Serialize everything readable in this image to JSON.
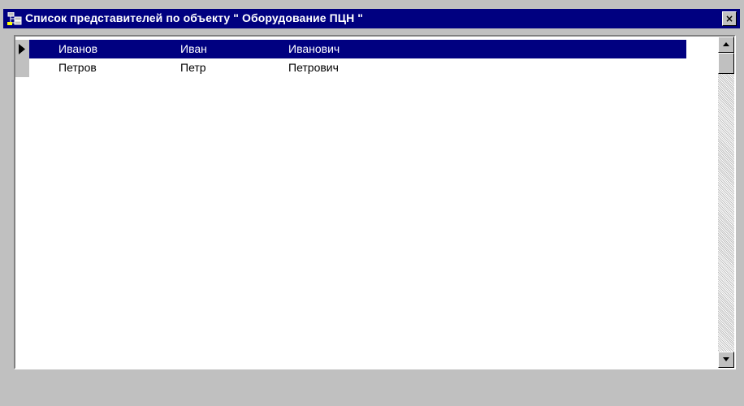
{
  "window": {
    "title": "Список представителей по объекту \" Оборудование ПЦН \"",
    "close_label": "×",
    "title_bar_color": "#000080",
    "selection_color": "#000080"
  },
  "grid": {
    "rows": [
      {
        "last_name": "Иванов",
        "first_name": "Иван",
        "patronymic": "Иванович",
        "selected": true
      },
      {
        "last_name": "Петров",
        "first_name": "Петр",
        "patronymic": "Петрович",
        "selected": false
      }
    ]
  },
  "icons": {
    "app": "tree-network-icon",
    "close": "close-icon",
    "row_indicator": "current-row-arrow-icon",
    "scroll_up": "scroll-up-arrow-icon",
    "scroll_down": "scroll-down-arrow-icon"
  },
  "scrollbar": {
    "position": 0
  }
}
